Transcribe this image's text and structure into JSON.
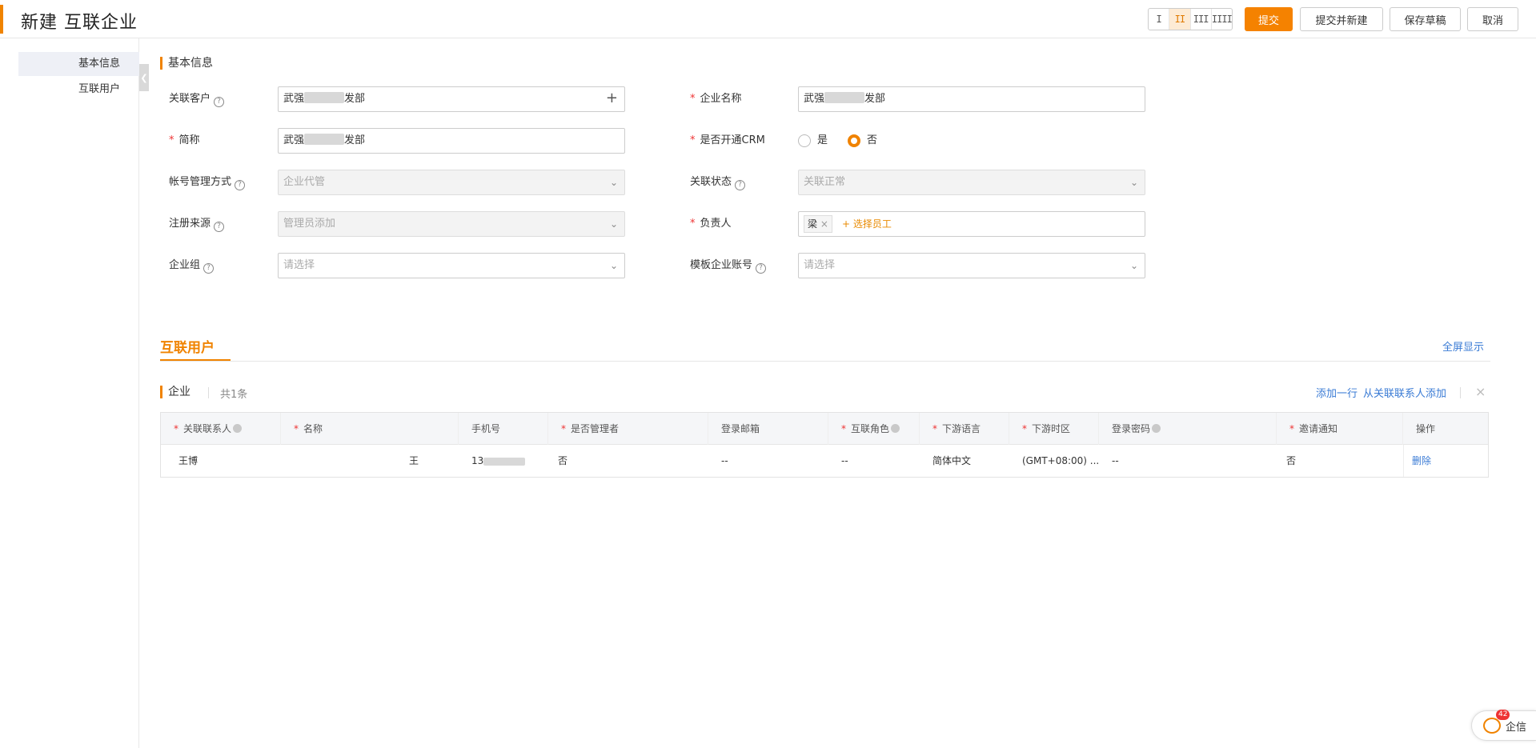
{
  "header": {
    "title": "新建 互联企业",
    "column_options": [
      "I",
      "II",
      "III",
      "IIII"
    ],
    "active_column": 1,
    "buttons": {
      "submit": "提交",
      "submit_new": "提交并新建",
      "save_draft": "保存草稿",
      "cancel": "取消"
    }
  },
  "nav": {
    "items": [
      "基本信息",
      "互联用户"
    ]
  },
  "basic_section": {
    "title": "基本信息"
  },
  "form": {
    "related_customer": {
      "label": "关联客户",
      "value_prefix": "武强",
      "value_suffix": "发部"
    },
    "company_name": {
      "label": "企业名称",
      "value_prefix": "武强",
      "value_suffix": "发部"
    },
    "short_name": {
      "label": "简称",
      "value_prefix": "武强",
      "value_suffix": "发部"
    },
    "open_crm": {
      "label": "是否开通CRM",
      "options": [
        "是",
        "否"
      ],
      "selected": "否"
    },
    "account_mode": {
      "label": "帐号管理方式",
      "value": "企业代管"
    },
    "link_status": {
      "label": "关联状态",
      "value": "关联正常"
    },
    "reg_source": {
      "label": "注册来源",
      "value": "管理员添加"
    },
    "owner": {
      "label": "负责人",
      "tag": "梁",
      "choose": "+ 选择员工"
    },
    "company_group": {
      "label": "企业组",
      "placeholder": "请选择"
    },
    "template_account": {
      "label": "模板企业账号",
      "placeholder": "请选择"
    }
  },
  "users_tab": {
    "title": "互联用户",
    "fullscreen": "全屏显示",
    "sub_title": "企业",
    "count": "共1条",
    "add_row": "添加一行",
    "add_from_contact": "从关联联系人添加",
    "close": "×"
  },
  "table": {
    "columns": [
      "关联联系人",
      "名称",
      "手机号",
      "是否管理者",
      "登录邮箱",
      "互联角色",
      "下游语言",
      "下游时区",
      "登录密码",
      "邀请通知",
      "操作"
    ],
    "rows": [
      [
        "王博",
        "王",
        "13",
        "否",
        "--",
        "--",
        "简体中文",
        "(GMT+08:00) ...",
        "--",
        "否",
        "删除"
      ]
    ]
  },
  "qixin": {
    "badge": "42",
    "label": "企信"
  }
}
